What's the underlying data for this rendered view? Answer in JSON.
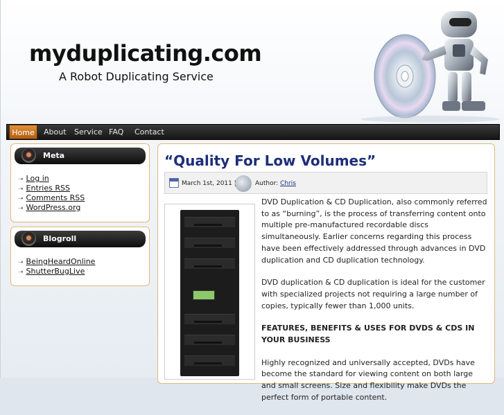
{
  "site": {
    "title": "myduplicating.com",
    "tagline": "A Robot Duplicating Service"
  },
  "nav": {
    "items": [
      {
        "label": "Home"
      },
      {
        "label": "About"
      },
      {
        "label": "Service"
      },
      {
        "label": "FAQ"
      },
      {
        "label": "Contact"
      }
    ]
  },
  "sidebar": {
    "meta": {
      "title": "Meta",
      "links": [
        "Log in",
        "Entries RSS",
        "Comments RSS",
        "WordPress.org"
      ]
    },
    "blogroll": {
      "title": "Blogroll",
      "links": [
        "BeingHeardOnline",
        "ShutterBugLive"
      ]
    }
  },
  "post": {
    "title": "“Quality For Low Volumes”",
    "date": "March 1st, 2011 |",
    "author_label": "Author:",
    "author": "Chris",
    "paragraph1": "DVD Duplication & CD Duplication, also commonly referred to as “burning”, is the process of transferring content onto multiple pre-manufactured recordable discs simultaneously. Earlier concerns regarding this process have been effectively addressed through advances in DVD duplication and CD duplication technology.",
    "paragraph2": "DVD duplication & CD duplication is ideal for the customer with specialized projects not requiring a large number of copies, typically fewer than 1,000 units.",
    "features_heading": "FEATURES, BENEFITS & USES FOR DVDS & CDS IN YOUR BUSINESS",
    "paragraph3": "Highly recognized and universally accepted, DVDs have become the standard for viewing content on both large and small screens. Size and flexibility make DVDs the perfect form of portable content."
  }
}
